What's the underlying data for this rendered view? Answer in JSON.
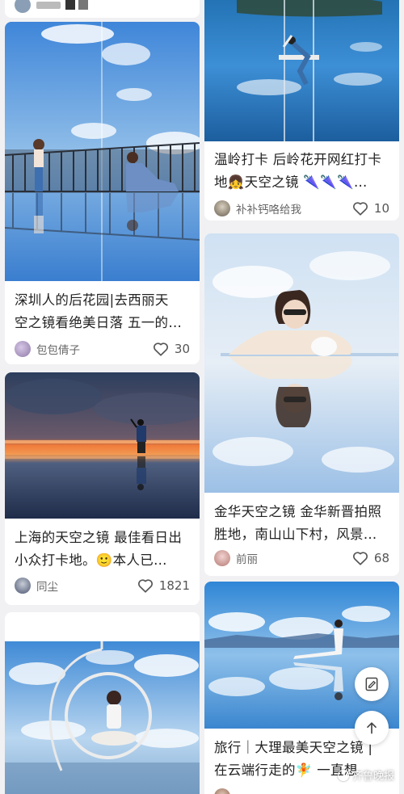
{
  "feed": {
    "left": [
      {
        "title_line1": "深圳人的后花园|去西丽天",
        "title_line2": "空之镜看绝美日落 五一的…",
        "author": "包包倩子",
        "likes": "30"
      },
      {
        "title_line1": "上海的天空之镜 最佳看日出",
        "title_line2": "小众打卡地。🙂本人已…",
        "author": "同尘",
        "likes": "1821"
      }
    ],
    "right": [
      {
        "title_line1": "温岭打卡 后岭花开网红打卡",
        "title_line2": "地👧天空之镜 🌂🌂🌂…",
        "author": "补补钙咯给我",
        "likes": "10"
      },
      {
        "title_line1": "金华天空之镜 金华新晋拍照",
        "title_line2": "胜地，南山山下村，风景…",
        "author": "前丽",
        "likes": "68"
      },
      {
        "title_line1": "旅行｜大理最美天空之镜 |",
        "title_line2": "在云端行走的🧚 一直想"
      }
    ]
  },
  "watermark": "齐鲁晚报",
  "icons": [
    "heart-icon",
    "edit-icon",
    "arrow-up-icon"
  ],
  "colors": {
    "card_bg": "#ffffff",
    "page_bg": "#f1f1f3",
    "sky_blue": "#3d8fd6"
  }
}
